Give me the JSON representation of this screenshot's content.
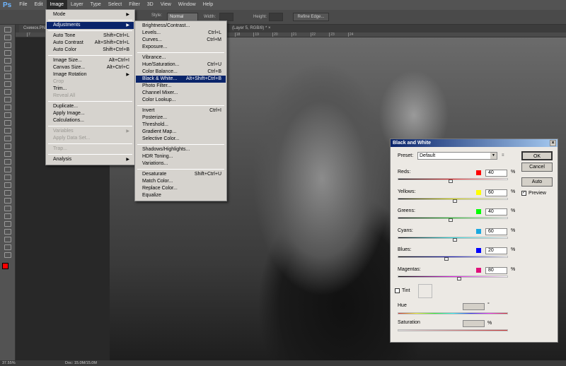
{
  "menubar": {
    "logo": "Ps",
    "items": [
      "File",
      "Edit",
      "Image",
      "Layer",
      "Type",
      "Select",
      "Filter",
      "3D",
      "View",
      "Window",
      "Help"
    ],
    "active": "Image"
  },
  "options": {
    "style_label": "Style:",
    "style_value": "Normal",
    "width_label": "Width:",
    "height_label": "Height:",
    "refine_edge": "Refine Edge..."
  },
  "tabs": [
    {
      "label": "Снимок.PN..."
    },
    {
      "label": "(Layer 5, RGB/8) * ×"
    }
  ],
  "ruler": [
    "7",
    "8",
    "9",
    "10",
    "11",
    "12",
    "13",
    "14",
    "15",
    "16",
    "17",
    "18",
    "19",
    "20",
    "21",
    "22",
    "23",
    "24"
  ],
  "image_menu": [
    {
      "label": "Mode",
      "arrow": true
    },
    {
      "sep": true
    },
    {
      "label": "Adjustments",
      "arrow": true,
      "selected": true
    },
    {
      "sep": true
    },
    {
      "label": "Auto Tone",
      "shortcut": "Shift+Ctrl+L"
    },
    {
      "label": "Auto Contrast",
      "shortcut": "Alt+Shift+Ctrl+L"
    },
    {
      "label": "Auto Color",
      "shortcut": "Shift+Ctrl+B"
    },
    {
      "sep": true
    },
    {
      "label": "Image Size...",
      "shortcut": "Alt+Ctrl+I"
    },
    {
      "label": "Canvas Size...",
      "shortcut": "Alt+Ctrl+C"
    },
    {
      "label": "Image Rotation",
      "arrow": true
    },
    {
      "label": "Crop",
      "disabled": true
    },
    {
      "label": "Trim..."
    },
    {
      "label": "Reveal All",
      "disabled": true
    },
    {
      "sep": true
    },
    {
      "label": "Duplicate..."
    },
    {
      "label": "Apply Image..."
    },
    {
      "label": "Calculations..."
    },
    {
      "sep": true
    },
    {
      "label": "Variables",
      "arrow": true,
      "disabled": true
    },
    {
      "label": "Apply Data Set...",
      "disabled": true
    },
    {
      "sep": true
    },
    {
      "label": "Trap...",
      "disabled": true
    },
    {
      "sep": true
    },
    {
      "label": "Analysis",
      "arrow": true
    }
  ],
  "adjustments_menu": [
    {
      "label": "Brightness/Contrast..."
    },
    {
      "label": "Levels...",
      "shortcut": "Ctrl+L"
    },
    {
      "label": "Curves...",
      "shortcut": "Ctrl+M"
    },
    {
      "label": "Exposure..."
    },
    {
      "sep": true
    },
    {
      "label": "Vibrance..."
    },
    {
      "label": "Hue/Saturation...",
      "shortcut": "Ctrl+U"
    },
    {
      "label": "Color Balance...",
      "shortcut": "Ctrl+B"
    },
    {
      "label": "Black & White...",
      "shortcut": "Alt+Shift+Ctrl+B",
      "selected": true
    },
    {
      "label": "Photo Filter..."
    },
    {
      "label": "Channel Mixer..."
    },
    {
      "label": "Color Lookup..."
    },
    {
      "sep": true
    },
    {
      "label": "Invert",
      "shortcut": "Ctrl+I"
    },
    {
      "label": "Posterize..."
    },
    {
      "label": "Threshold..."
    },
    {
      "label": "Gradient Map..."
    },
    {
      "label": "Selective Color..."
    },
    {
      "sep": true
    },
    {
      "label": "Shadows/Highlights..."
    },
    {
      "label": "HDR Toning..."
    },
    {
      "label": "Variations..."
    },
    {
      "sep": true
    },
    {
      "label": "Desaturate",
      "shortcut": "Shift+Ctrl+U"
    },
    {
      "label": "Match Color..."
    },
    {
      "label": "Replace Color..."
    },
    {
      "label": "Equalize"
    }
  ],
  "dialog": {
    "title": "Black and White",
    "preset_label": "Preset:",
    "preset_value": "Default",
    "ok": "OK",
    "cancel": "Cancel",
    "auto": "Auto",
    "preview": "Preview",
    "preview_checked": true,
    "channels": [
      {
        "label": "Reds:",
        "value": "40",
        "color": "#ff0000",
        "grad": "linear-gradient(90deg,#000,#ff3030,#fff)"
      },
      {
        "label": "Yellows:",
        "value": "60",
        "color": "#ffff00",
        "grad": "linear-gradient(90deg,#000,#e0e000,#fff)"
      },
      {
        "label": "Greens:",
        "value": "40",
        "color": "#00ff00",
        "grad": "linear-gradient(90deg,#000,#30d030,#fff)"
      },
      {
        "label": "Cyans:",
        "value": "60",
        "color": "#1aa8e0",
        "grad": "linear-gradient(90deg,#000,#30e0e0,#fff)"
      },
      {
        "label": "Blues:",
        "value": "20",
        "color": "#0000ff",
        "grad": "linear-gradient(90deg,#000,#2020c0,#fff)"
      },
      {
        "label": "Magentas:",
        "value": "80",
        "color": "#e0107a",
        "grad": "linear-gradient(90deg,#000,#e020e0,#fff)"
      }
    ],
    "slider_range": [
      -200,
      300
    ],
    "percent": "%",
    "tint_label": "Tint",
    "tint_checked": false,
    "hue_label": "Hue",
    "hue_unit": "°",
    "saturation_label": "Saturation",
    "saturation_unit": "%"
  },
  "status": {
    "zoom": "37.55%",
    "doc": "Doc: 15.0M/15.0M"
  }
}
